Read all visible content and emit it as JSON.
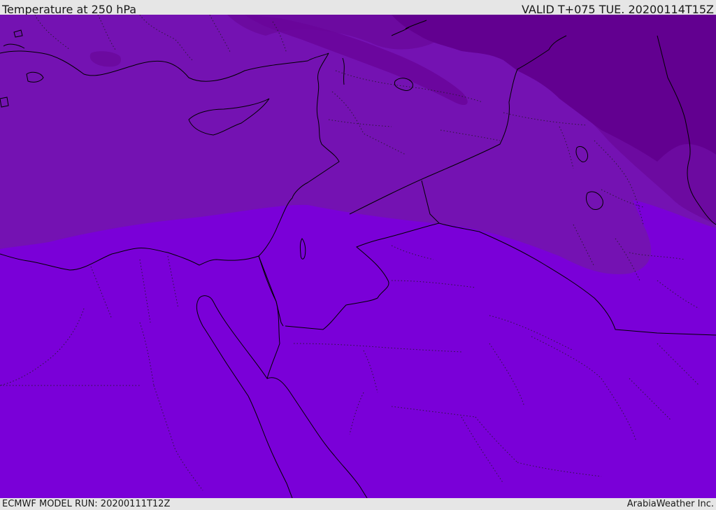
{
  "header": {
    "title": "Temperature at 250 hPa",
    "valid_time": "VALID T+075 TUE. 20200114T15Z"
  },
  "footer": {
    "model_run": "ECMWF MODEL RUN: 20200111T12Z",
    "provider": "ArabiaWeather Inc."
  },
  "colors": {
    "band_warm": "#7a00d8",
    "band_mid": "#7412b2",
    "band_cool": "#6c0aa0",
    "band_cold": "#620090"
  }
}
